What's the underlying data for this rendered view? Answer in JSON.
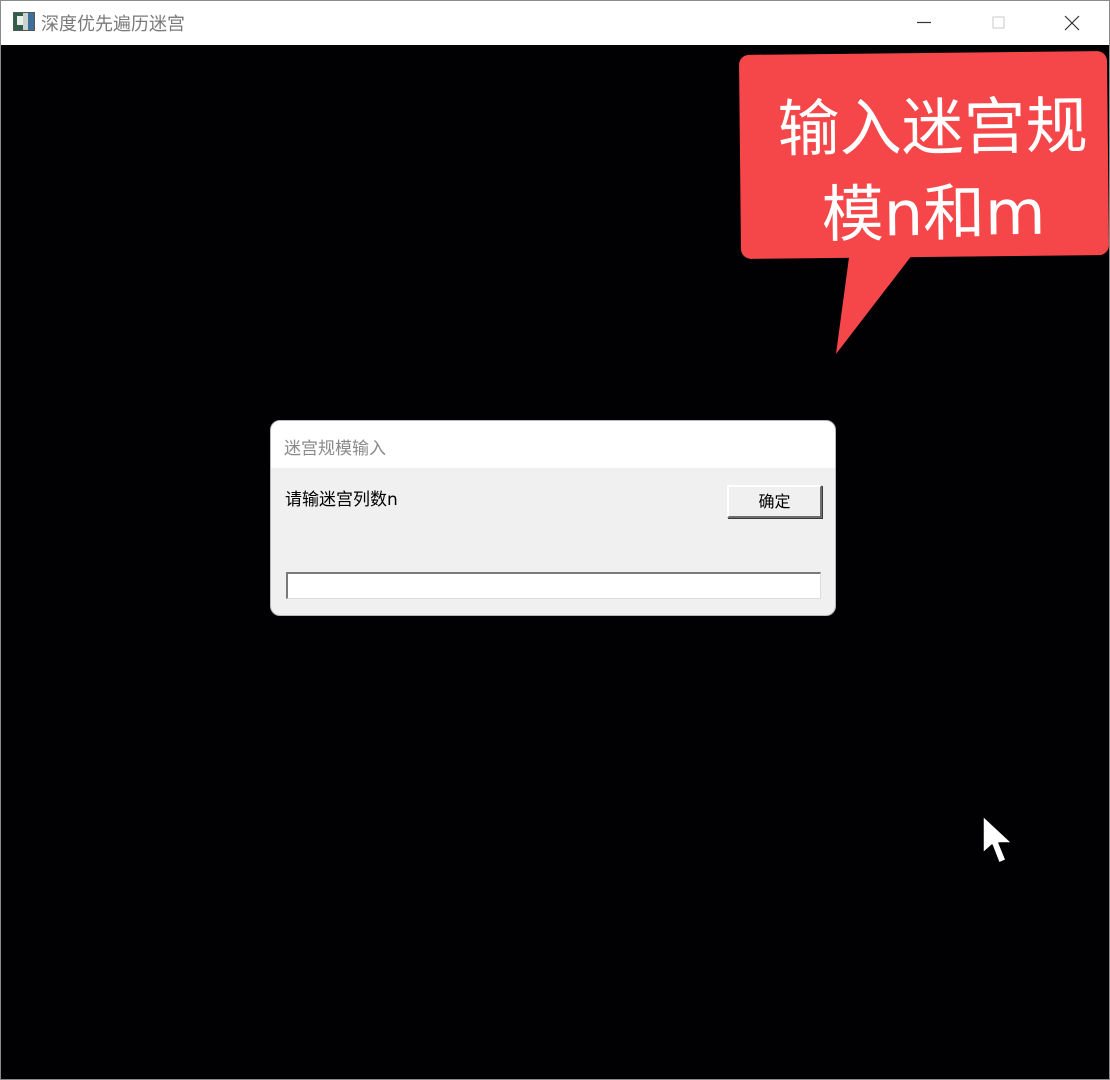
{
  "window": {
    "title": "深度优先遍历迷宫",
    "icon": "maze-app-icon",
    "controls": [
      "minimize-icon",
      "maximize-icon",
      "close-icon"
    ]
  },
  "callout": {
    "line1": "输入迷宫规",
    "line2": "模n和m",
    "color": "#f5464a"
  },
  "dialog": {
    "title": "迷宫规模输入",
    "prompt": "请输迷宫列数n",
    "ok_label": "确定",
    "input_value": "",
    "input_placeholder": ""
  },
  "colors": {
    "canvas_background": "#010104",
    "dialog_background": "#f0f0f0"
  }
}
